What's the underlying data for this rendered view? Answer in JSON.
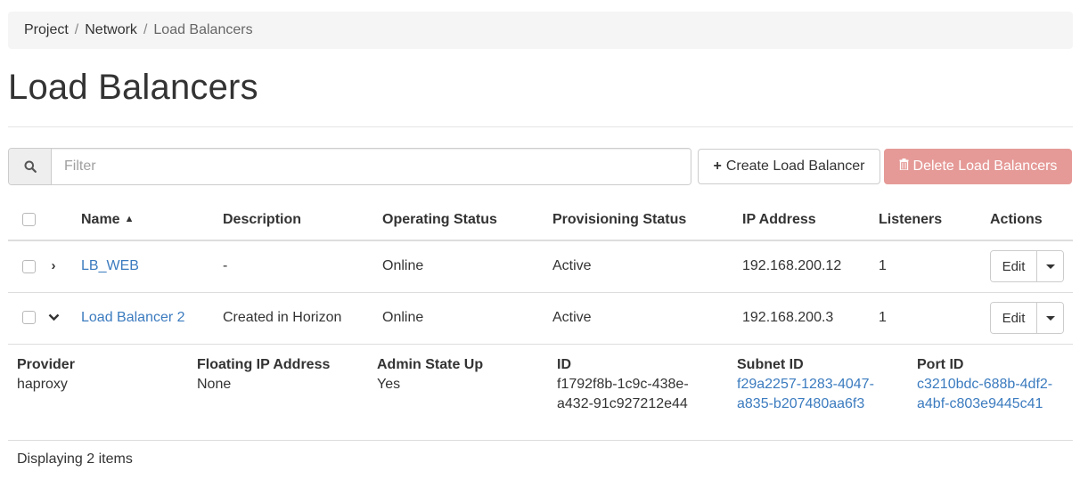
{
  "breadcrumb": [
    "Project",
    "Network",
    "Load Balancers"
  ],
  "breadcrumb_separator": "/",
  "page_title": "Load Balancers",
  "filter": {
    "placeholder": "Filter",
    "icon": "search-icon"
  },
  "buttons": {
    "create_label": "Create Load Balancer",
    "create_icon": "plus-icon",
    "delete_label": "Delete Load Balancers",
    "delete_icon": "trash-icon"
  },
  "table": {
    "headers": {
      "name": "Name",
      "description": "Description",
      "operating_status": "Operating Status",
      "provisioning_status": "Provisioning Status",
      "ip_address": "IP Address",
      "listeners": "Listeners",
      "actions": "Actions"
    },
    "sorted_by": "name",
    "sort_direction": "ascending",
    "rows": [
      {
        "name": "LB_WEB",
        "description": "-",
        "operating_status": "Online",
        "provisioning_status": "Active",
        "ip_address": "192.168.200.12",
        "listeners": "1",
        "action_label": "Edit",
        "expanded": false
      },
      {
        "name": "Load Balancer 2",
        "description": "Created in Horizon",
        "operating_status": "Online",
        "provisioning_status": "Active",
        "ip_address": "192.168.200.3",
        "listeners": "1",
        "action_label": "Edit",
        "expanded": true
      }
    ]
  },
  "detail": {
    "provider_label": "Provider",
    "provider_value": "haproxy",
    "floating_ip_label": "Floating IP Address",
    "floating_ip_value": "None",
    "admin_state_label": "Admin State Up",
    "admin_state_value": "Yes",
    "id_label": "ID",
    "id_line1": "f1792f8b-1c9c-438e-",
    "id_line2": "a432-91c927212e44",
    "subnet_label": "Subnet ID",
    "subnet_line1": "f29a2257-1283-4047-",
    "subnet_line2": "a835-b207480aa6f3",
    "port_label": "Port ID",
    "port_line1": "c3210bdc-688b-4df2-",
    "port_line2": "a4bf-c803e9445c41"
  },
  "footer": {
    "count_text": "Displaying 2 items"
  },
  "colors": {
    "link": "#3b7bbf",
    "danger_button_disabled": "#e59a97",
    "breadcrumb_bg": "#f5f5f5"
  }
}
